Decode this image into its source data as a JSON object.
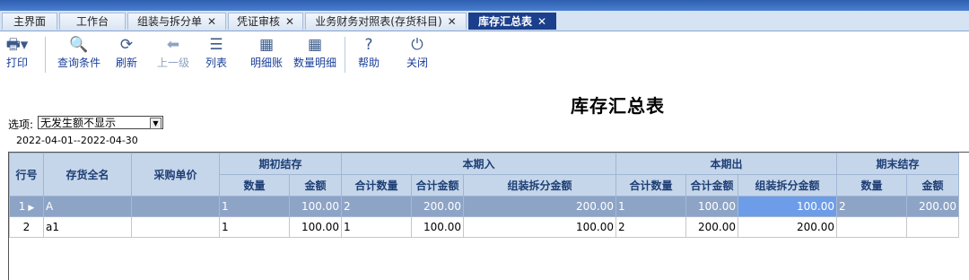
{
  "tabs": [
    {
      "label": "主界面",
      "closable": false
    },
    {
      "label": "工作台",
      "closable": false
    },
    {
      "label": "组装与拆分单",
      "closable": true
    },
    {
      "label": "凭证审核",
      "closable": true
    },
    {
      "label": "业务财务对照表(存货科目)",
      "closable": true
    },
    {
      "label": "库存汇总表",
      "closable": true,
      "active": true
    }
  ],
  "close_glyph": "✕",
  "toolbar": {
    "print": "打印",
    "query": "查询条件",
    "refresh": "刷新",
    "up": "上一级",
    "list": "列表",
    "detail": "明细账",
    "qty_detail": "数量明细",
    "help": "帮助",
    "close": "关闭"
  },
  "report": {
    "title": "库存汇总表",
    "option_label": "选项:",
    "option_value": "无发生额不显示",
    "date_range": "2022-04-01--2022-04-30"
  },
  "table": {
    "headers": {
      "row_no": "行号",
      "item_name": "存货全名",
      "purchase_unit": "采购单价",
      "opening": "期初结存",
      "inbound": "本期入",
      "outbound": "本期出",
      "closing": "期末结存",
      "qty": "数量",
      "amount": "金额",
      "total_qty": "合计数量",
      "total_amount": "合计金额",
      "assembly_amount": "组装拆分金额"
    },
    "rows": [
      {
        "no": "1",
        "name": "A",
        "unit": "",
        "open_qty": "1",
        "open_amt": "100.00",
        "in_qty": "2",
        "in_amt": "200.00",
        "in_asm": "200.00",
        "out_qty": "1",
        "out_amt": "100.00",
        "out_asm": "100.00",
        "close_qty": "2",
        "close_amt": "200.00"
      },
      {
        "no": "2",
        "name": "a1",
        "unit": "",
        "open_qty": "1",
        "open_amt": "100.00",
        "in_qty": "1",
        "in_amt": "100.00",
        "in_asm": "100.00",
        "out_qty": "2",
        "out_amt": "200.00",
        "out_asm": "200.00",
        "close_qty": "",
        "close_amt": ""
      }
    ]
  }
}
